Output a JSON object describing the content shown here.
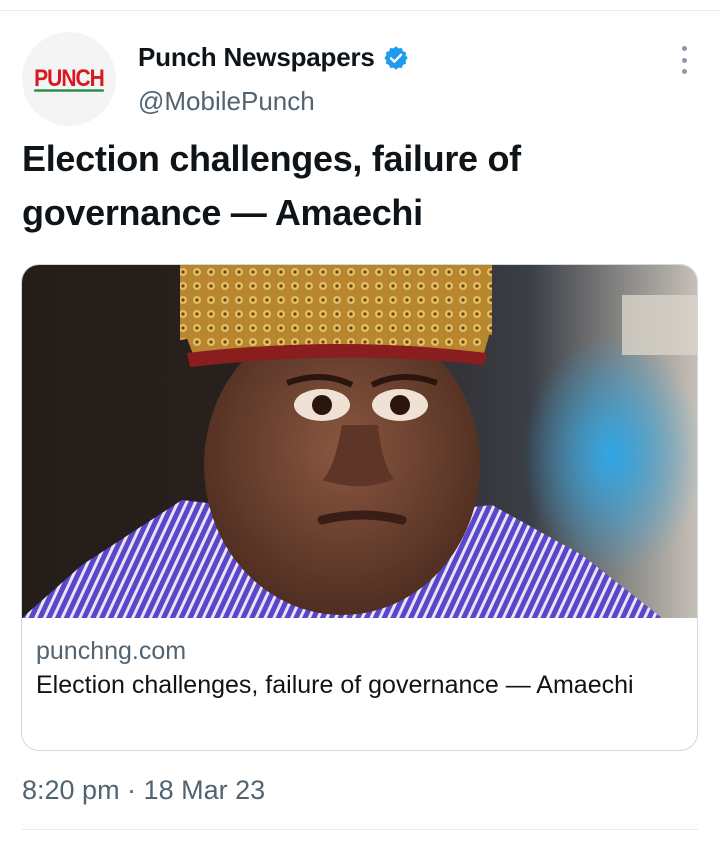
{
  "account": {
    "display_name": "Punch Newspapers",
    "handle": "@MobilePunch",
    "avatar_logo_text": "PUNCH",
    "verified": true
  },
  "tweet": {
    "text": "Election challenges, failure of governance — Amaechi",
    "timestamp": "8:20 pm · 18 Mar 23"
  },
  "link_card": {
    "domain": "punchng.com",
    "title": "Election challenges, failure of governance — Amaechi",
    "image_subject": "photo-of-man-in-purple-striped-shirt-and-gold-embroidered-cap"
  },
  "icons": {
    "verified": "verified-badge-icon",
    "more": "more-options-icon"
  },
  "colors": {
    "verified_blue": "#1d9bf0",
    "logo_red": "#d71920",
    "logo_green": "#1c8a3a",
    "secondary_text": "#536471"
  }
}
